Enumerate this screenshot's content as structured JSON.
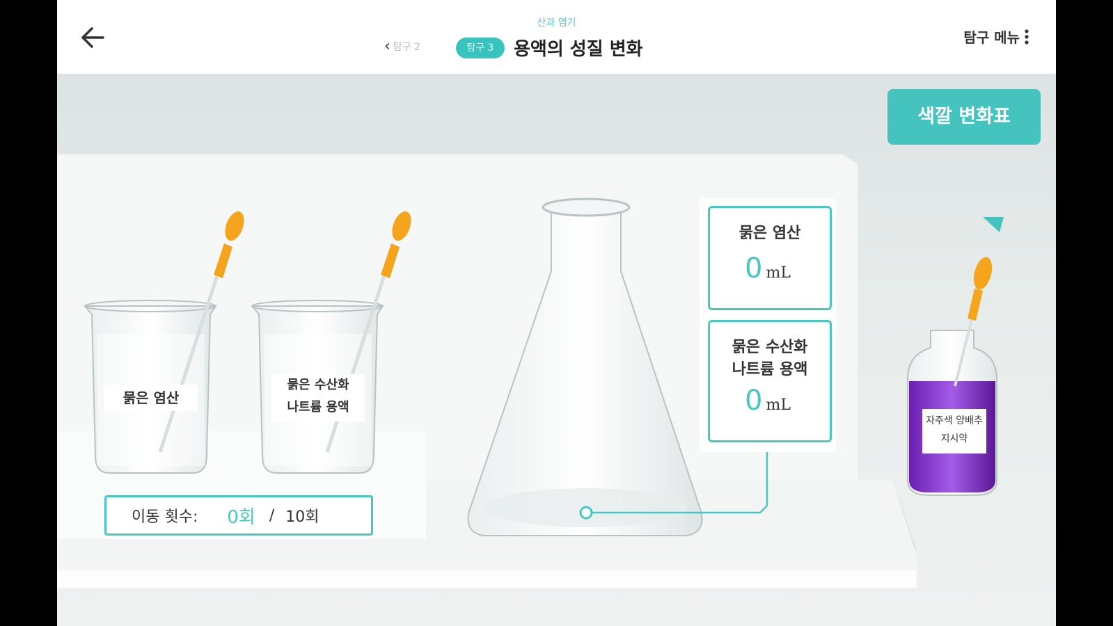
{
  "header": {
    "crumb": "산과 염기",
    "prev_link": "탐구 2",
    "badge": "탐구 3",
    "title": "용액의 성질 변화",
    "menu_label": "탐구 메뉴"
  },
  "beakers": [
    {
      "label": "묽은 염산"
    },
    {
      "label_line1": "묽은 수산화",
      "label_line2": "나트륨 용액"
    }
  ],
  "flask_readouts": [
    {
      "label": "묽은 염산",
      "value": "0",
      "unit": "mL"
    },
    {
      "label_line1": "묽은 수산화",
      "label_line2": "나트륨 용액",
      "value": "0",
      "unit": "mL"
    }
  ],
  "color_chart_button": "색깔 변화표",
  "indicator_bottle": {
    "label_line1": "자주색 양배추",
    "label_line2": "지시약"
  },
  "move_counter": {
    "label": "이동 횟수:",
    "count": "0회",
    "separator": "/",
    "max": "10회"
  },
  "colors": {
    "accent": "#48c7c2",
    "indicator": "#8a2fd0",
    "dropper": "#f4a51d"
  }
}
